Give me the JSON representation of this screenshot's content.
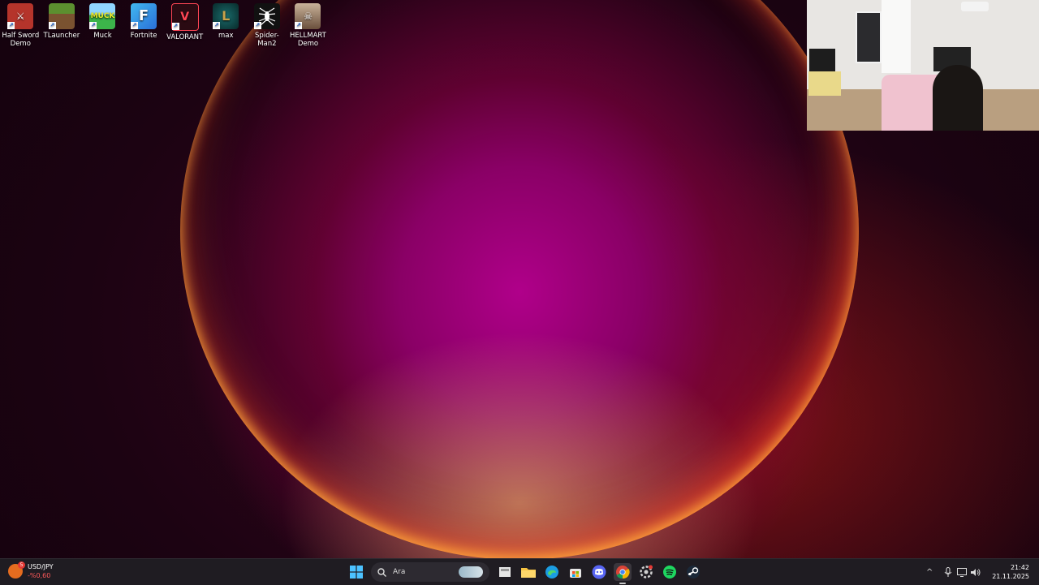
{
  "desktop": {
    "icons": [
      {
        "label": "Half Sword Demo",
        "icon": "half-sword-icon",
        "color": "#b5342b"
      },
      {
        "label": "TLauncher",
        "icon": "minecraft-block-icon",
        "color": "#5c8f2f"
      },
      {
        "label": "Muck",
        "icon": "muck-icon",
        "color": "#3cb44a"
      },
      {
        "label": "Fortnite",
        "icon": "fortnite-icon",
        "color": "#2a8de0"
      },
      {
        "label": "VALORANT",
        "icon": "valorant-icon",
        "color": "#3a0a12"
      },
      {
        "label": "max",
        "icon": "league-of-legends-icon",
        "color": "#0b3d3d"
      },
      {
        "label": "Spider-Man2",
        "icon": "spider-icon",
        "color": "#111111"
      },
      {
        "label": "HELLMART Demo",
        "icon": "hellmart-icon",
        "color": "#8a6f5a"
      }
    ]
  },
  "taskbar": {
    "widget": {
      "title": "USD/JPY",
      "change": "-%0,60",
      "icon": "stocks-widget-icon",
      "badge": "5"
    },
    "search": {
      "placeholder": "Ara"
    },
    "apps": [
      {
        "name": "start-button",
        "icon": "windows-icon"
      },
      {
        "name": "task-view",
        "icon": "task-view-icon"
      },
      {
        "name": "file-explorer",
        "icon": "folder-icon"
      },
      {
        "name": "edge",
        "icon": "edge-icon"
      },
      {
        "name": "microsoft-store",
        "icon": "store-icon"
      },
      {
        "name": "discord",
        "icon": "discord-icon"
      },
      {
        "name": "chrome",
        "icon": "chrome-icon"
      },
      {
        "name": "settings",
        "icon": "gear-icon"
      },
      {
        "name": "spotify",
        "icon": "spotify-icon"
      },
      {
        "name": "steam",
        "icon": "steam-icon"
      }
    ],
    "clock": {
      "time": "21:42",
      "date": "21.11.2025"
    }
  },
  "accent_colors": {
    "taskbar": "#1f1c22",
    "wallpaper_glow": "#b0008a",
    "stock_down": "#ff5a5a"
  }
}
